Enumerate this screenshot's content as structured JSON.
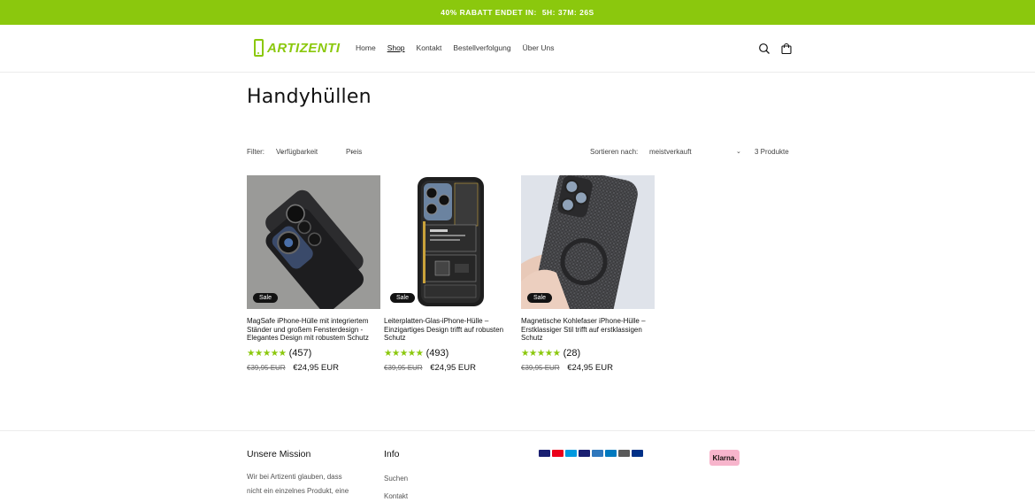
{
  "announcement": {
    "text": "40% RABATT ENDET IN:",
    "timer": "5H: 37M: 26S"
  },
  "header": {
    "logo": "ARTIZENTI",
    "nav": [
      "Home",
      "Shop",
      "Kontakt",
      "Bestellverfolgung",
      "Über Uns"
    ],
    "active_nav": "Shop",
    "icons": [
      "search-icon",
      "cart-icon"
    ]
  },
  "page": {
    "title": "Handyhüllen"
  },
  "facets": {
    "filter_label": "Filter:",
    "availability": "Verfügbarkeit",
    "price": "Preis",
    "sort_label": "Sortieren nach:",
    "sort_value": "meistverkauft",
    "count": "3 Produkte"
  },
  "products": [
    {
      "title": "MagSafe iPhone-Hülle mit integriertem Ständer und großem Fensterdesign - Elegantes Design mit robustem Schutz",
      "badge": "Sale",
      "rating_count": "(457)",
      "old_price": "€39,95 EUR",
      "price": "€24,95 EUR",
      "rating": 5
    },
    {
      "title": "Leiterplatten-Glas-iPhone-Hülle – Einzigartiges Design trifft auf robusten Schutz",
      "badge": "Sale",
      "rating_count": "(493)",
      "old_price": "€39,95 EUR",
      "price": "€24,95 EUR",
      "rating": 5
    },
    {
      "title": "Magnetische Kohlefaser iPhone-Hülle – Erstklassiger Stil trifft auf erstklassigen Schutz",
      "badge": "Sale",
      "rating_count": "(28)",
      "old_price": "€39,95 EUR",
      "price": "€24,95 EUR",
      "rating": 5
    }
  ],
  "footer": {
    "mission_heading": "Unsere Mission",
    "mission_line1": "Wir bei Artizenti glauben, dass",
    "mission_line2": "nicht ein einzelnes Produkt, eine",
    "info_heading": "Info",
    "info_links": [
      "Suchen",
      "Kontakt"
    ],
    "klarna": "Klarna.",
    "payments": [
      {
        "name": "VISA",
        "color": "#1a1f71"
      },
      {
        "name": "MC",
        "color": "#eb001b"
      },
      {
        "name": "MAE",
        "color": "#0099df"
      },
      {
        "name": "VISA",
        "color": "#1a1f71"
      },
      {
        "name": "AMEX",
        "color": "#2e77bc"
      },
      {
        "name": "DC",
        "color": "#0079be"
      },
      {
        "name": "ApP",
        "color": "#5a5a5a"
      },
      {
        "name": "PP",
        "color": "#003087"
      }
    ]
  },
  "colors": {
    "accent": "#8bc80d",
    "badge": "#121212",
    "klarna": "#f7b5cc"
  }
}
